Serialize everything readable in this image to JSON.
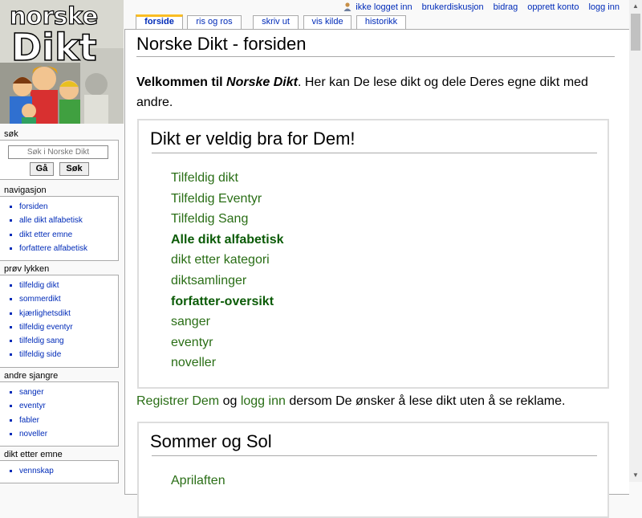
{
  "logo": {
    "line1": "norske",
    "line2": "Dikt"
  },
  "personal_tools": [
    "ikke logget inn",
    "brukerdiskusjon",
    "bidrag",
    "opprett konto",
    "logg inn"
  ],
  "tabs": [
    "forside",
    "ris og ros",
    "skriv ut",
    "vis kilde",
    "historikk"
  ],
  "search": {
    "heading": "søk",
    "placeholder": "Søk i Norske Dikt",
    "go_label": "Gå",
    "search_label": "Søk"
  },
  "navigation": {
    "heading": "navigasjon",
    "items": [
      "forsiden",
      "alle dikt alfabetisk",
      "dikt etter emne",
      "forfattere alfabetisk"
    ]
  },
  "luck": {
    "heading": "prøv lykken",
    "items": [
      "tilfeldig dikt",
      "sommerdikt",
      "kjærlighetsdikt",
      "tilfeldig eventyr",
      "tilfeldig sang",
      "tilfeldig side"
    ]
  },
  "genres": {
    "heading": "andre sjangre",
    "items": [
      "sanger",
      "eventyr",
      "fabler",
      "noveller"
    ]
  },
  "topics": {
    "heading": "dikt etter emne",
    "items": [
      "vennskap"
    ]
  },
  "page": {
    "title": "Norske Dikt - forsiden",
    "welcome_bold": "Velkommen til ",
    "welcome_italic": "Norske Dikt",
    "welcome_after": ". Her kan De lese dikt og dele Deres egne dikt med andre.",
    "box1": {
      "heading": "Dikt er veldig bra for Dem!",
      "links": [
        "Tilfeldig dikt",
        "Tilfeldig Eventyr",
        "Tilfeldig Sang",
        "Alle dikt alfabetisk",
        "dikt etter kategori",
        "diktsamlinger",
        "forfatter-oversikt",
        "sanger",
        "eventyr",
        "noveller"
      ]
    },
    "register": {
      "link1": "Registrer Dem",
      "mid1": " og ",
      "link2": "logg inn",
      "rest": " dersom De ønsker å lese dikt uten å se reklame."
    },
    "box2": {
      "heading": "Sommer og Sol",
      "links": [
        "Aprilaften"
      ]
    }
  },
  "colors": {
    "link": "#002bb8",
    "content_link": "#2a6e16",
    "tab_selected": "#fabd23"
  }
}
